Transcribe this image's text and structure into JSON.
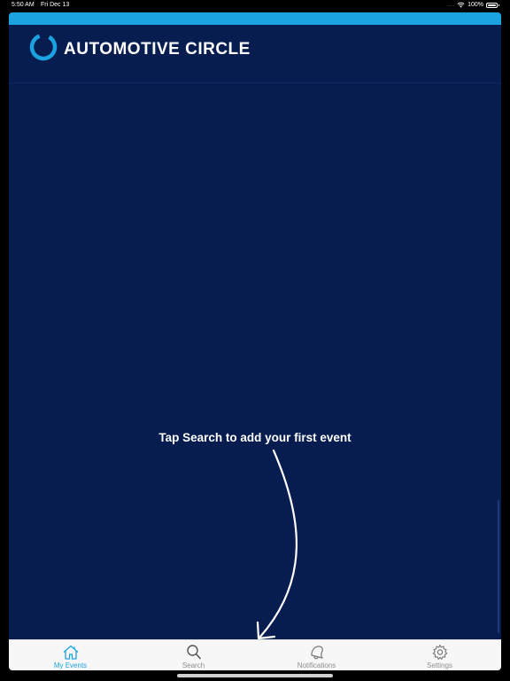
{
  "status_bar": {
    "time": "5:50 AM",
    "date": "Fri Dec 13",
    "signal": ".....",
    "battery": "100%"
  },
  "brand": {
    "name": "AUTOMOTIVE CIRCLE",
    "accent_color": "#1aa3e0",
    "background_color": "#071d4f"
  },
  "empty_state": {
    "message": "Tap Search to add your first event"
  },
  "tabs": [
    {
      "label": "My Events",
      "icon": "home-icon",
      "active": true
    },
    {
      "label": "Search",
      "icon": "search-icon",
      "active": false
    },
    {
      "label": "Notifications",
      "icon": "bell-icon",
      "active": false
    },
    {
      "label": "Settings",
      "icon": "gear-icon",
      "active": false
    }
  ]
}
